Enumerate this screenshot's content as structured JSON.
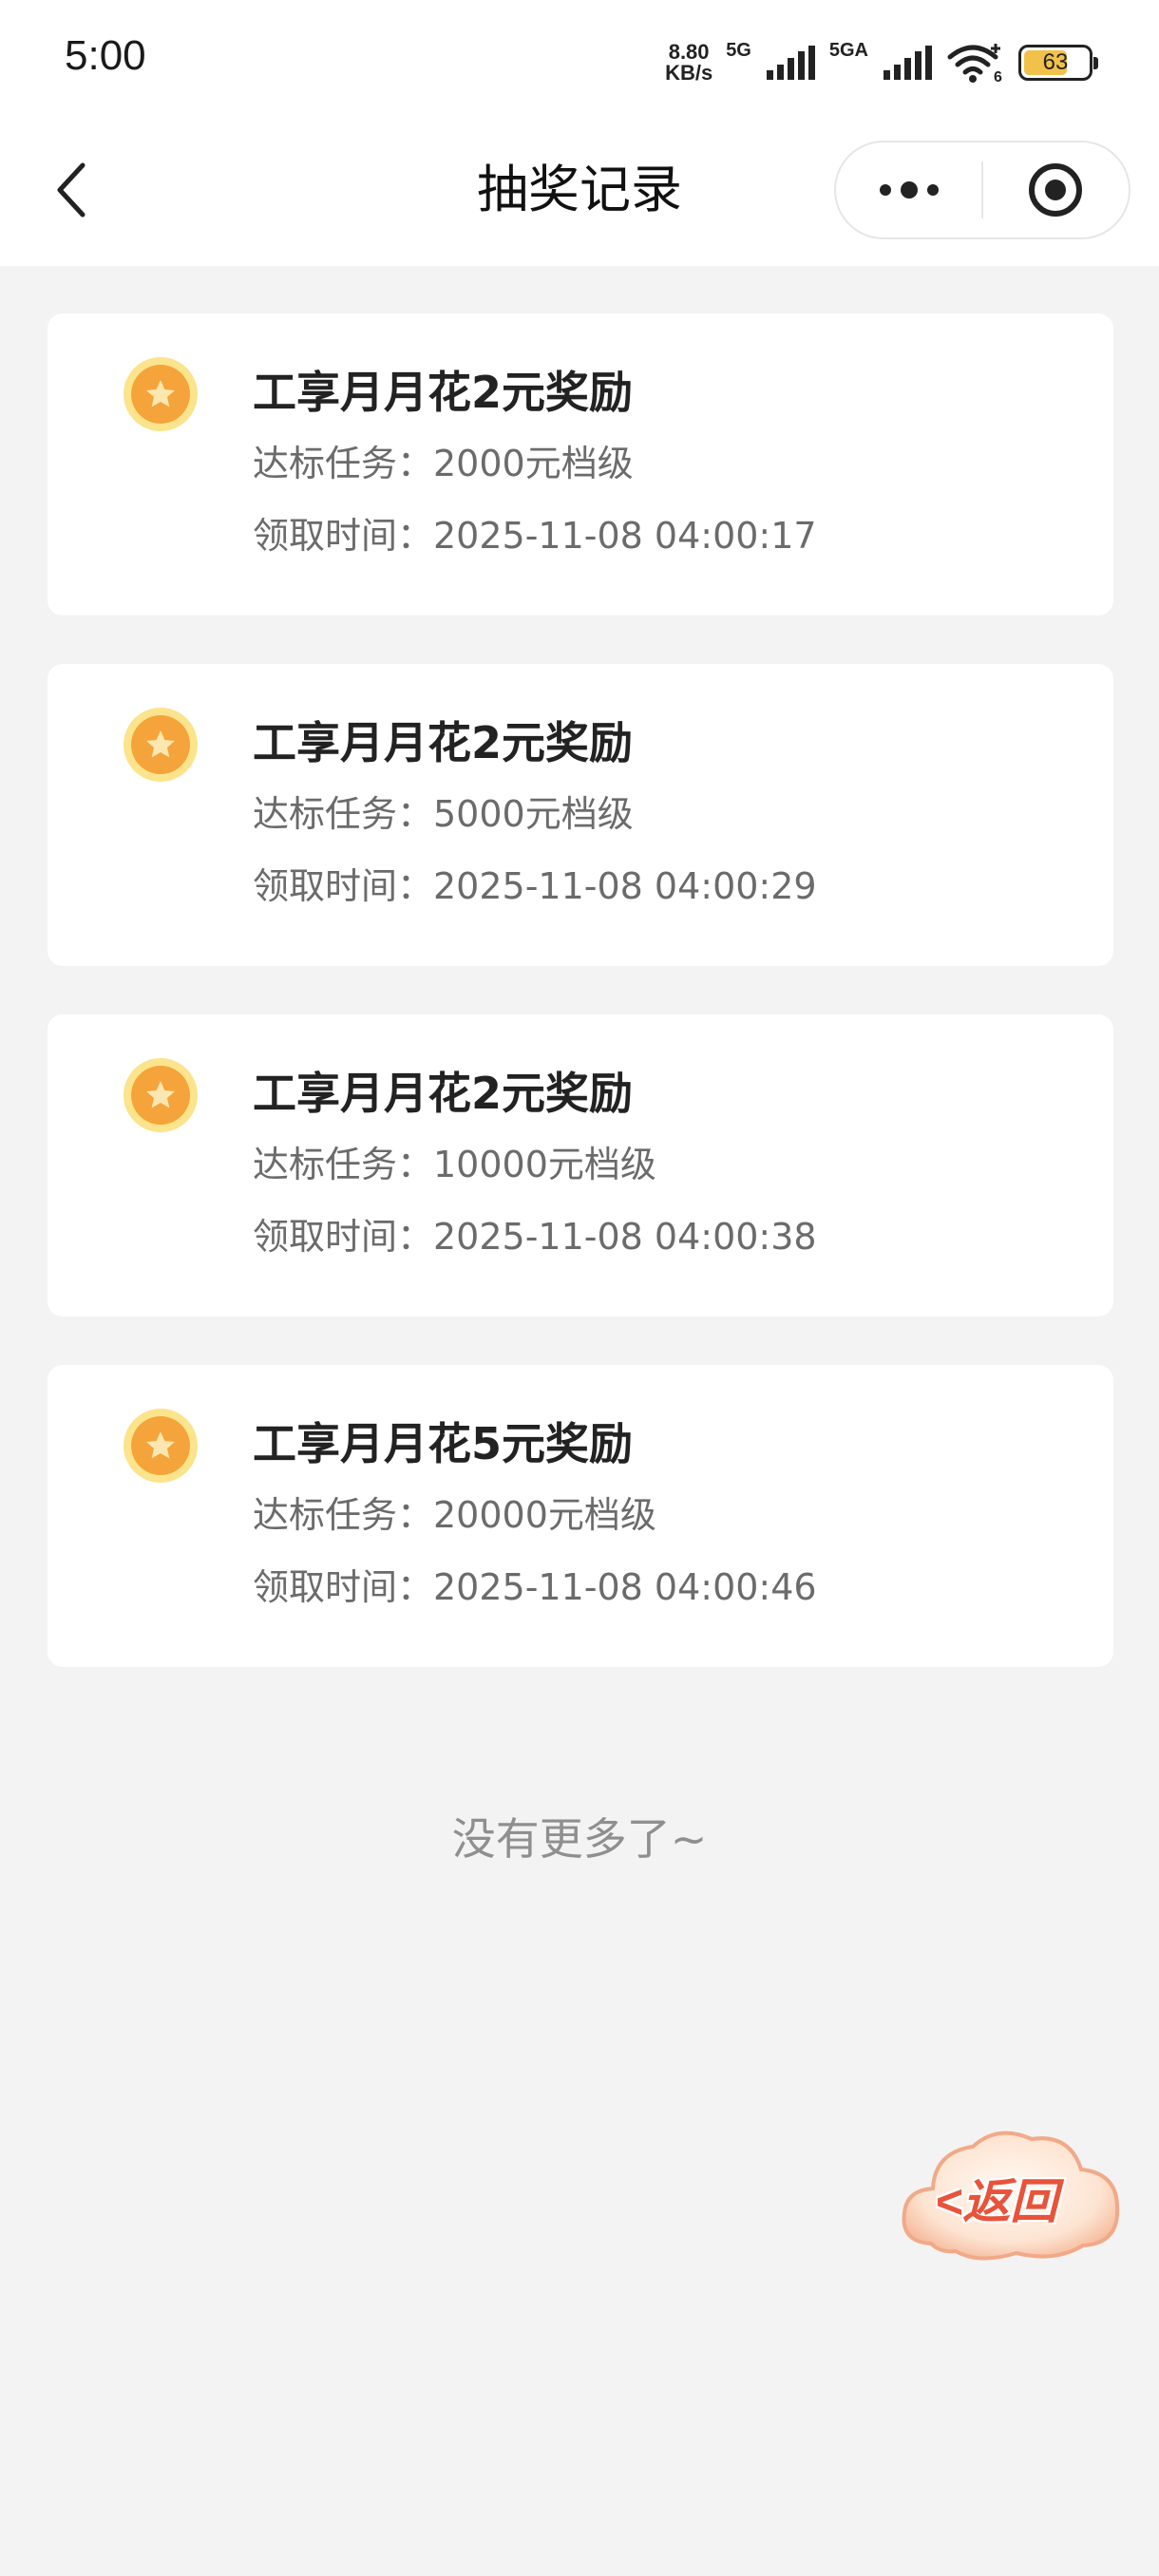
{
  "status_bar": {
    "time": "5:00",
    "net_speed_value": "8.80",
    "net_speed_unit": "KB/s",
    "sim1_label": "5G",
    "sim2_label": "5GA",
    "wifi_label": "6",
    "battery_level": "63"
  },
  "nav": {
    "title": "抽奖记录"
  },
  "records": [
    {
      "title": "工享月月花2元奖励",
      "task": "达标任务：2000元档级",
      "time": "领取时间：2025-11-08 04:00:17"
    },
    {
      "title": "工享月月花2元奖励",
      "task": "达标任务：5000元档级",
      "time": "领取时间：2025-11-08 04:00:29"
    },
    {
      "title": "工享月月花2元奖励",
      "task": "达标任务：10000元档级",
      "time": "领取时间：2025-11-08 04:00:38"
    },
    {
      "title": "工享月月花5元奖励",
      "task": "达标任务：20000元档级",
      "time": "领取时间：2025-11-08 04:00:46"
    }
  ],
  "footer": {
    "no_more": "没有更多了~"
  },
  "floating_button": {
    "label": "<返回"
  },
  "colors": {
    "background": "#f3f3f3",
    "card": "#ffffff",
    "coin_outer": "#fbe48c",
    "coin_inner": "#f4a43a",
    "return_text": "#e8533a"
  },
  "icons": {
    "back": "chevron-left-icon",
    "more": "more-dots-icon",
    "close": "target-circle-icon",
    "coin": "star-coin-icon"
  }
}
